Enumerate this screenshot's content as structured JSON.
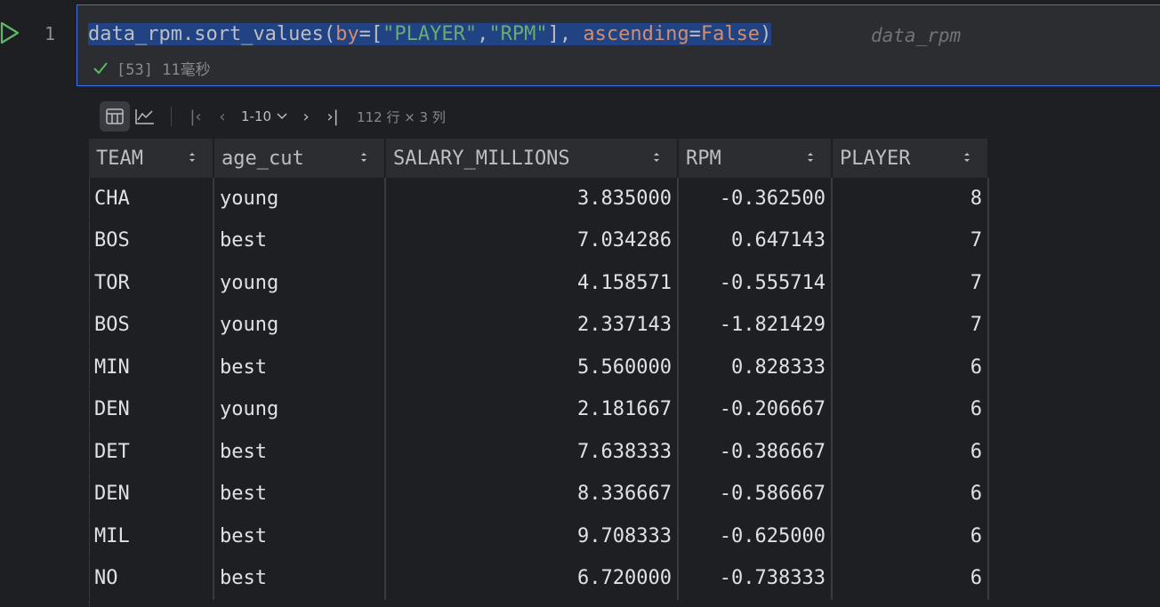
{
  "gutter": {
    "line_number": "1"
  },
  "cell": {
    "code": {
      "fn": "data_rpm.sort_values(",
      "by_kw": "by",
      "eq1": "=[",
      "s1": "\"PLAYER\"",
      "comma": ",",
      "s2": "\"RPM\"",
      "close_list": "], ",
      "asc_kw": "ascending",
      "eq2": "=",
      "false_kw": "False",
      "close_paren": ")"
    },
    "hint": "data_rpm",
    "exec_status": "[53] 11毫秒"
  },
  "toolbar": {
    "page_range": "1-10",
    "size_info": "112 行 × 3 列"
  },
  "table": {
    "columns": [
      "TEAM",
      "age_cut",
      "SALARY_MILLIONS",
      "RPM",
      "PLAYER"
    ],
    "rows": [
      [
        "CHA",
        "young",
        "3.835000",
        "-0.362500",
        "8"
      ],
      [
        "BOS",
        "best",
        "7.034286",
        "0.647143",
        "7"
      ],
      [
        "TOR",
        "young",
        "4.158571",
        "-0.555714",
        "7"
      ],
      [
        "BOS",
        "young",
        "2.337143",
        "-1.821429",
        "7"
      ],
      [
        "MIN",
        "best",
        "5.560000",
        "0.828333",
        "6"
      ],
      [
        "DEN",
        "young",
        "2.181667",
        "-0.206667",
        "6"
      ],
      [
        "DET",
        "best",
        "7.638333",
        "-0.386667",
        "6"
      ],
      [
        "DEN",
        "best",
        "8.336667",
        "-0.586667",
        "6"
      ],
      [
        "MIL",
        "best",
        "9.708333",
        "-0.625000",
        "6"
      ],
      [
        "NO",
        "best",
        "6.720000",
        "-0.738333",
        "6"
      ]
    ]
  },
  "colors": {
    "selection": "#214283",
    "accent_border": "#3574f0",
    "success": "#5fb865",
    "string": "#6aab73",
    "keyword": "#cf8e6d"
  }
}
